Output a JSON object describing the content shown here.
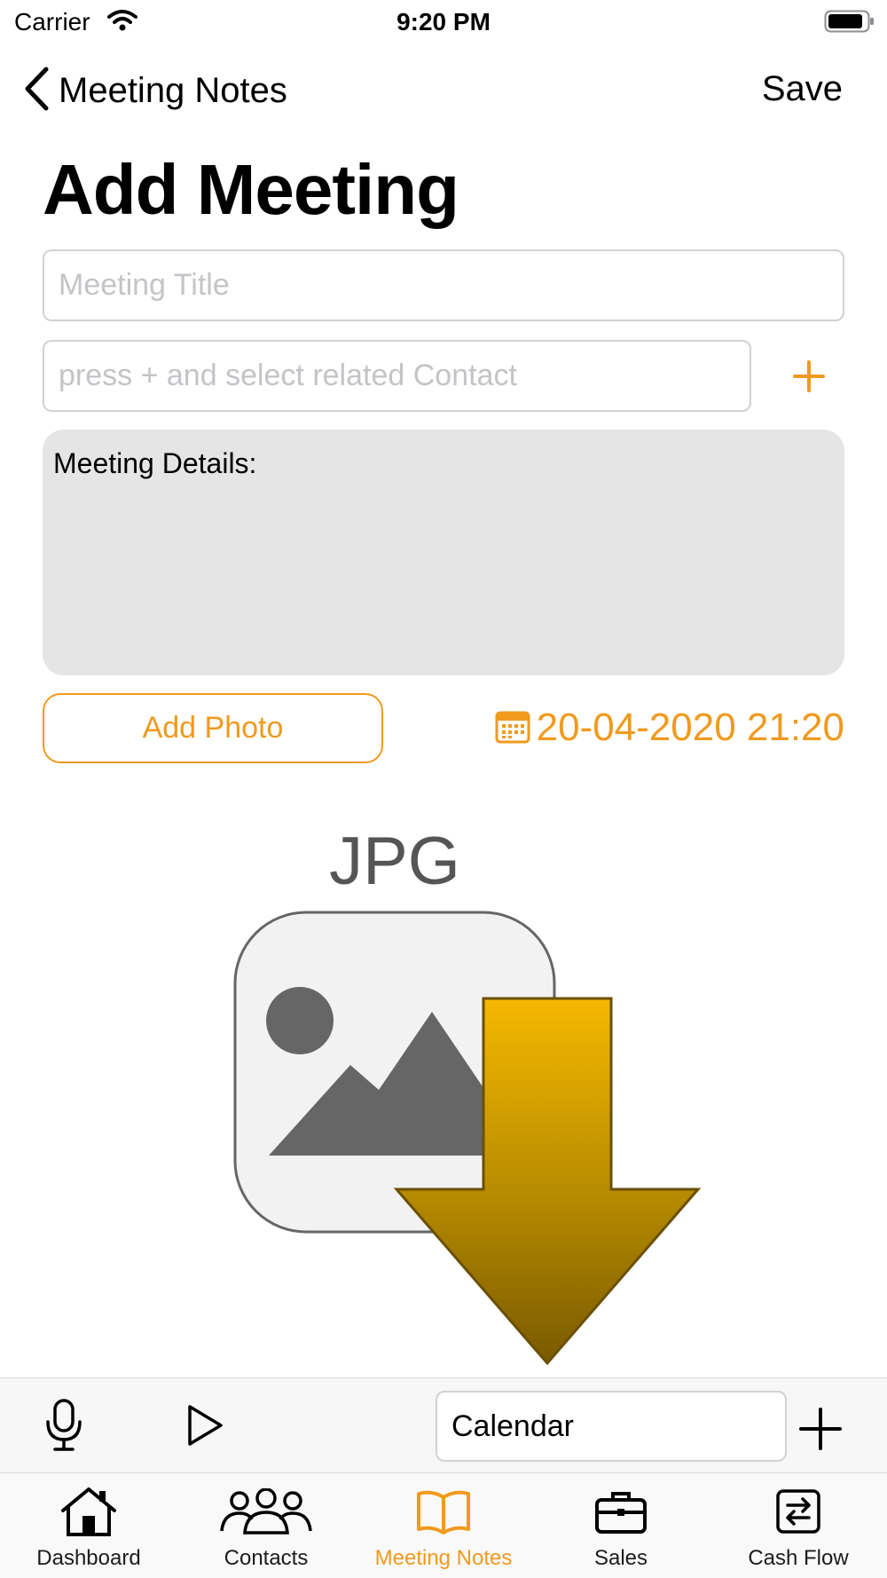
{
  "status_bar": {
    "carrier": "Carrier",
    "time": "9:20 PM"
  },
  "nav": {
    "back_label": "Meeting Notes",
    "save_label": "Save"
  },
  "page_title": "Add Meeting",
  "form": {
    "meeting_title_placeholder": "Meeting Title",
    "meeting_title_value": "",
    "contact_placeholder": "press + and select related Contact",
    "contact_value": "",
    "details_label": "Meeting Details:",
    "add_photo_label": "Add Photo",
    "date_label": "20-04-2020 21:20"
  },
  "image_placeholder": {
    "label": "JPG"
  },
  "toolbar": {
    "calendar_value": "Calendar"
  },
  "tabs": [
    {
      "label": "Dashboard",
      "icon": "house-icon",
      "active": false
    },
    {
      "label": "Contacts",
      "icon": "people-icon",
      "active": false
    },
    {
      "label": "Meeting Notes",
      "icon": "book-icon",
      "active": true
    },
    {
      "label": "Sales",
      "icon": "briefcase-icon",
      "active": false
    },
    {
      "label": "Cash Flow",
      "icon": "exchange-icon",
      "active": false
    }
  ],
  "colors": {
    "accent": "#f09a1e",
    "details_background": "#e5e5e5",
    "arrow_top": "#f5b800",
    "arrow_bottom": "#7a5a00"
  }
}
